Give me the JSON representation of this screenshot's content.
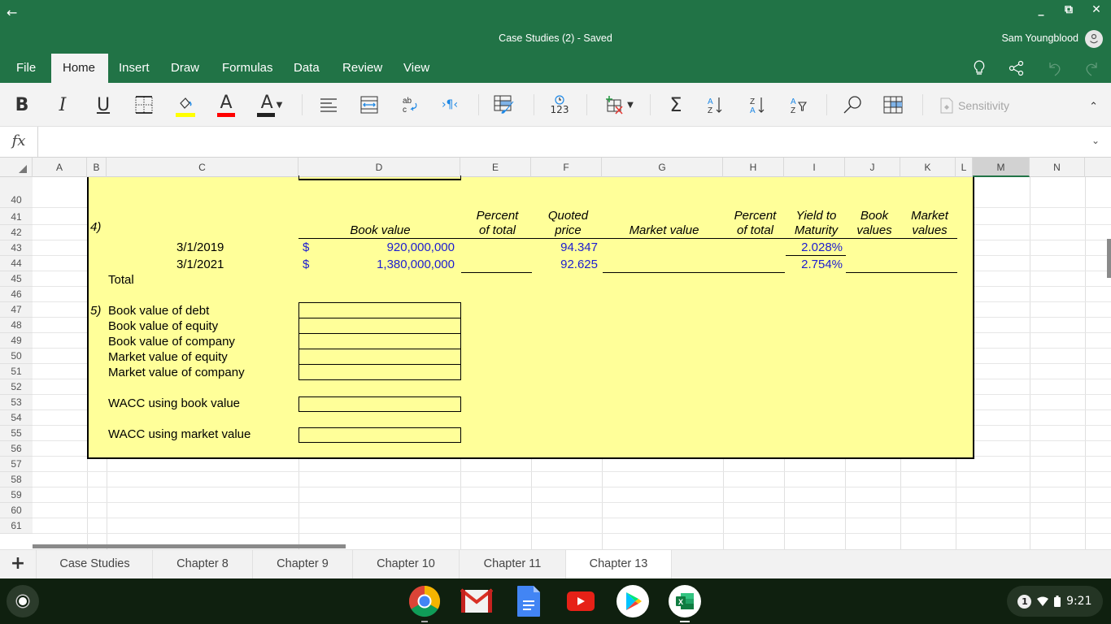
{
  "window": {
    "title": "Case Studies (2) - Saved",
    "user_name": "Sam Youngblood",
    "controls": {
      "minimize": "_",
      "restore": "⧉",
      "close": "✕"
    }
  },
  "ribbon": {
    "tabs": [
      {
        "label": "File",
        "active": false
      },
      {
        "label": "Home",
        "active": true
      },
      {
        "label": "Insert",
        "active": false
      },
      {
        "label": "Draw",
        "active": false
      },
      {
        "label": "Formulas",
        "active": false
      },
      {
        "label": "Data",
        "active": false
      },
      {
        "label": "Review",
        "active": false
      },
      {
        "label": "View",
        "active": false
      }
    ],
    "right_icons": [
      "lightbulb-icon",
      "share-icon",
      "undo-icon",
      "redo-icon"
    ]
  },
  "toolbar": {
    "buttons": [
      {
        "name": "bold-button",
        "glyph": "B"
      },
      {
        "name": "italic-button",
        "glyph": "I"
      },
      {
        "name": "underline-button",
        "glyph": "U"
      },
      {
        "name": "borders-button",
        "glyph": "▦"
      },
      {
        "name": "fill-color-button",
        "glyph": "◇",
        "swatch": "#ffff00"
      },
      {
        "name": "font-color-button",
        "glyph": "A",
        "swatch": "#ff0000"
      },
      {
        "name": "font-format-button",
        "glyph": "A",
        "swatch": "#222222"
      },
      {
        "name": "align-button",
        "glyph": "≡"
      },
      {
        "name": "merge-button",
        "glyph": "⇔"
      },
      {
        "name": "wrap-text-button",
        "glyph": "ab"
      },
      {
        "name": "text-direction-button",
        "glyph": "›¶‹"
      },
      {
        "name": "format-as-table-button",
        "glyph": "▤"
      },
      {
        "name": "number-format-button",
        "glyph": "123"
      },
      {
        "name": "insert-delete-cells-button",
        "glyph": "⊞"
      },
      {
        "name": "autosum-button",
        "glyph": "Σ"
      },
      {
        "name": "sort-ascending-button",
        "glyph": "A↓"
      },
      {
        "name": "sort-descending-button",
        "glyph": "Z↓"
      },
      {
        "name": "filter-button",
        "glyph": "▽"
      },
      {
        "name": "find-button",
        "glyph": "⚲"
      },
      {
        "name": "freeze-panes-button",
        "glyph": "▦"
      }
    ],
    "sensitivity_label": "Sensitivity"
  },
  "formula_bar": {
    "fx": "fx",
    "value": ""
  },
  "columns": [
    "A",
    "B",
    "C",
    "D",
    "E",
    "F",
    "G",
    "H",
    "I",
    "J",
    "K",
    "L",
    "M",
    "N"
  ],
  "selected_column": "M",
  "rows": [
    "40",
    "41",
    "42",
    "43",
    "44",
    "45",
    "46",
    "47",
    "48",
    "49",
    "50",
    "51",
    "52",
    "53",
    "54",
    "55",
    "56",
    "57",
    "58",
    "59",
    "60",
    "61"
  ],
  "sheet": {
    "section4": {
      "label": "4)",
      "headers": {
        "book_value": "Book value",
        "percent_of_total_1_line1": "Percent",
        "percent_of_total_1_line2": "of total",
        "quoted_price_line1": "Quoted",
        "quoted_price_line2": "price",
        "market_value": "Market value",
        "percent_of_total_2_line1": "Percent",
        "percent_of_total_2_line2": "of total",
        "ytm_line1": "Yield to",
        "ytm_line2": "Maturity",
        "book_values_line1": "Book",
        "book_values_line2": "values",
        "market_values_line1": "Market",
        "market_values_line2": "values"
      },
      "bonds": [
        {
          "date": "3/1/2019",
          "currency": "$",
          "book_value": "920,000,000",
          "quoted_price": "94.347",
          "ytm": "2.028%"
        },
        {
          "date": "3/1/2021",
          "currency": "$",
          "book_value": "1,380,000,000",
          "quoted_price": "92.625",
          "ytm": "2.754%"
        }
      ],
      "total_label": "Total"
    },
    "section5": {
      "label": "5)",
      "items": [
        {
          "label": "Book value of debt",
          "value": ""
        },
        {
          "label": "Book value of equity",
          "value": ""
        },
        {
          "label": "Book value of company",
          "value": ""
        },
        {
          "label": "Market value of equity",
          "value": ""
        },
        {
          "label": "Market value of company",
          "value": ""
        }
      ],
      "wacc_book": {
        "label": "WACC using book value",
        "value": ""
      },
      "wacc_market": {
        "label": "WACC using market value",
        "value": ""
      }
    }
  },
  "sheet_tabs": [
    {
      "label": "Case Studies",
      "active": false
    },
    {
      "label": "Chapter 8",
      "active": false
    },
    {
      "label": "Chapter 9",
      "active": false
    },
    {
      "label": "Chapter 10",
      "active": false
    },
    {
      "label": "Chapter 11",
      "active": false
    },
    {
      "label": "Chapter 13",
      "active": true
    }
  ],
  "shelf": {
    "apps": [
      "Chrome",
      "Gmail",
      "Docs",
      "YouTube",
      "Play Store",
      "Excel"
    ],
    "notification_count": "1",
    "time": "9:21"
  }
}
